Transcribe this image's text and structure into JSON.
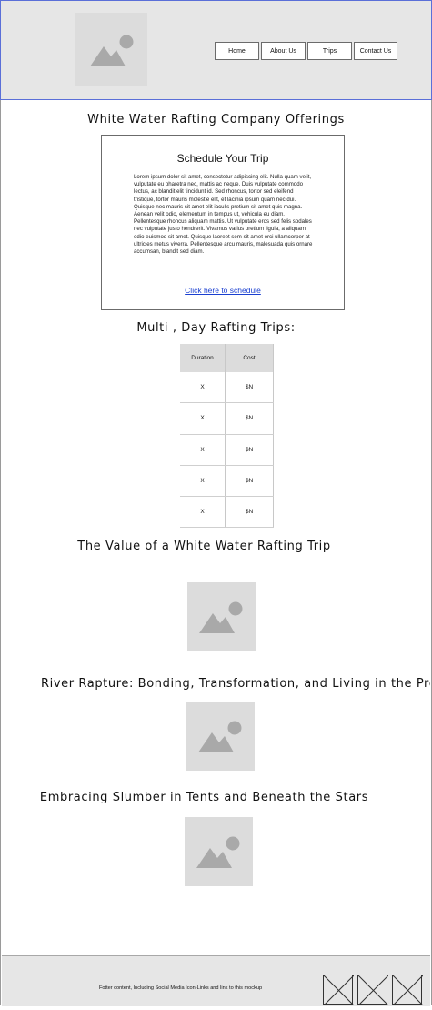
{
  "header": {
    "logo_icon": "image-placeholder-icon",
    "nav": [
      "Home",
      "About Us",
      "Trips",
      "Contact Us"
    ]
  },
  "main": {
    "heading": "White Water Rafting Company Offerings",
    "schedule": {
      "title": "Schedule Your Trip",
      "body": "Lorem ipsum dolor sit amet, consectetur adipiscing elit. Nulla quam velit, vulputate eu pharetra nec, mattis ac neque. Duis vulputate commodo lectus, ac blandit elit tincidunt id. Sed rhoncus, tortor sed eleifend tristique, tortor mauris molestie elit, et lacinia ipsum quam nec dui. Quisque nec mauris sit amet elit iaculis pretium sit amet quis magna. Aenean velit odio, elementum in tempus ut, vehicula eu diam. Pellentesque rhoncus aliquam mattis. Ut vulputate eros sed felis sodales nec vulputate justo hendrerit. Vivamus varius pretium ligula, a aliquam odio euismod sit amet. Quisque laoreet sem sit amet orci ullamcorper at ultricies metus viverra. Pellentesque arcu mauris, malesuada quis ornare accumsan, blandit sed diam.",
      "link": "Click here to schedule"
    },
    "trips_heading": "Multi , Day Rafting Trips:",
    "table": {
      "headers": [
        "Duration",
        "Cost"
      ],
      "rows": [
        [
          "X",
          "$N"
        ],
        [
          "X",
          "$N"
        ],
        [
          "X",
          "$N"
        ],
        [
          "X",
          "$N"
        ],
        [
          "X",
          "$N"
        ]
      ]
    },
    "value_heading": "The Value of a White Water Rafting Trip",
    "river_heading": "River Rapture: Bonding, Transformation, and Living in the Present",
    "slumber_heading": "Embracing Slumber in Tents and Beneath the Stars",
    "image_icon": "image-placeholder-icon"
  },
  "footer": {
    "text": "Fotter content, Including Social Media Icon-Links and link to this mockup",
    "social_icons": [
      "social-placeholder-icon",
      "social-placeholder-icon",
      "social-placeholder-icon"
    ]
  }
}
